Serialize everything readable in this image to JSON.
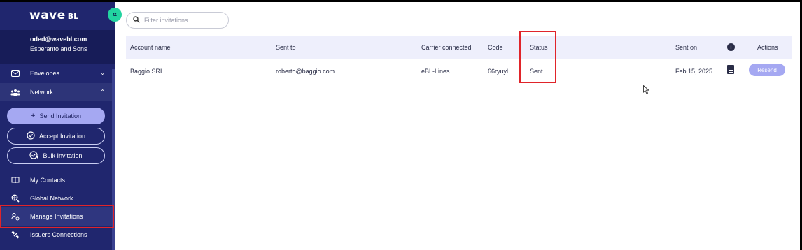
{
  "app": {
    "logo": "wave",
    "logo_suffix": "BL",
    "collapse_icon": "double-chevron-left-icon"
  },
  "user": {
    "email": "oded@wavebl.com",
    "company": "Esperanto and Sons"
  },
  "sidebar": {
    "items": [
      {
        "label": "Envelopes",
        "icon": "envelope-icon"
      },
      {
        "label": "Network",
        "icon": "network-icon"
      },
      {
        "label": "My Contacts",
        "icon": "book-icon"
      },
      {
        "label": "Global Network",
        "icon": "search-globe-icon"
      },
      {
        "label": "Manage Invitations",
        "icon": "manage-invitations-icon"
      },
      {
        "label": "Issuers Connections",
        "icon": "connections-icon"
      }
    ],
    "network_actions": [
      {
        "label": "Send Invitation",
        "icon": "plus-icon"
      },
      {
        "label": "Accept Invitation",
        "icon": "check-circle-icon"
      },
      {
        "label": "Bulk Invitation",
        "icon": "bulk-check-icon"
      }
    ]
  },
  "search": {
    "placeholder": "Filter invitations",
    "value": ""
  },
  "table": {
    "columns": [
      "Account name",
      "Sent to",
      "Carrier connected",
      "Code",
      "Status",
      "Sent on",
      "Actions"
    ],
    "rows": [
      {
        "account_name": "Baggio SRL",
        "sent_to": "roberto@baggio.com",
        "carrier": "eBL-Lines",
        "code": "66ryuyl",
        "status": "Sent",
        "sent_on": "Feb 15, 2025",
        "action_label": "Resend"
      }
    ]
  },
  "colors": {
    "sidebar_bg": "#20266e",
    "accent": "#a5a8f2",
    "collapse_button": "#22d3a0",
    "highlight_box": "#e0242a",
    "table_header_bg": "#eeeffc"
  }
}
